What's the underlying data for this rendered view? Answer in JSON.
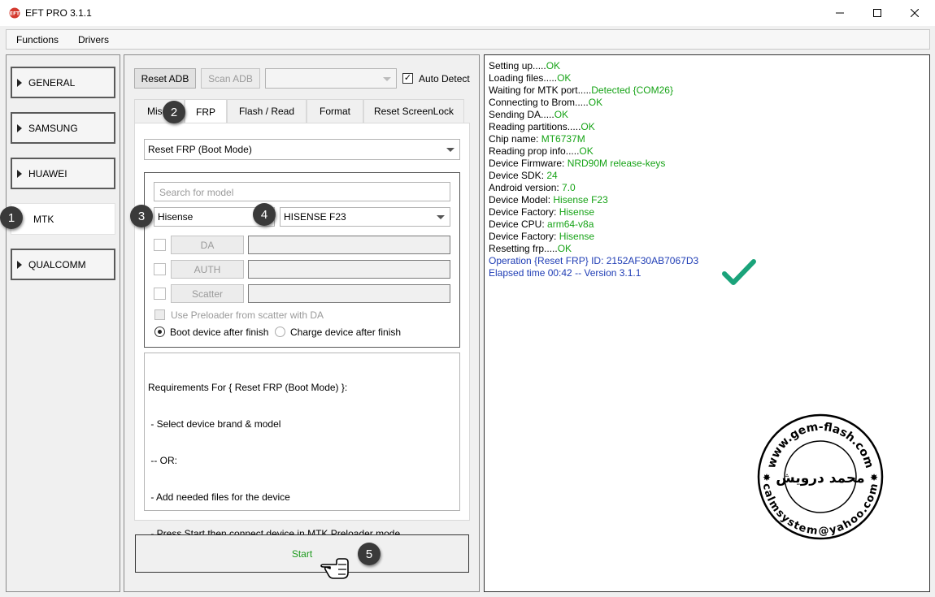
{
  "window": {
    "title": "EFT PRO 3.1.1",
    "controls": [
      "minimize-icon",
      "maximize-icon",
      "close-icon"
    ]
  },
  "menu": {
    "items": [
      "Functions",
      "Drivers"
    ]
  },
  "sidebar": {
    "items": [
      {
        "label": "GENERAL",
        "active": false
      },
      {
        "label": "SAMSUNG",
        "active": false
      },
      {
        "label": "HUAWEI",
        "active": false
      },
      {
        "label": "MTK",
        "active": true
      },
      {
        "label": "QUALCOMM",
        "active": false
      }
    ]
  },
  "toolbar": {
    "reset_adb": "Reset ADB",
    "scan_adb": "Scan ADB",
    "port_value": "",
    "auto_detect": "Auto Detect",
    "auto_detect_checked": true
  },
  "tabs": [
    {
      "label": "Misc",
      "active": false
    },
    {
      "label": "FRP",
      "active": true
    },
    {
      "label": "Flash / Read",
      "active": false
    },
    {
      "label": "Format",
      "active": false
    },
    {
      "label": "Reset ScreenLock",
      "active": false
    }
  ],
  "frp": {
    "mode_value": "Reset FRP (Boot Mode)",
    "search_placeholder": "Search for model",
    "brand_value": "Hisense",
    "model_value": "HISENSE F23",
    "da_label": "DA",
    "auth_label": "AUTH",
    "scatter_label": "Scatter",
    "use_preloader": "Use Preloader from scatter with DA",
    "boot_after": "Boot device after finish",
    "charge_after": "Charge device after finish",
    "boot_after_selected": true
  },
  "requirements": [
    "Requirements For { Reset FRP (Boot Mode) }:",
    " - Select device brand & model",
    " -- OR:",
    " - Add needed files for the device",
    " - Press Start then connect device in MTK Preloader mode"
  ],
  "start_label": "Start",
  "badges": [
    "1",
    "2",
    "3",
    "4",
    "5"
  ],
  "log": [
    {
      "label": "Setting up.....",
      "value": "OK"
    },
    {
      "label": "Loading files.....",
      "value": "OK"
    },
    {
      "label": "Waiting for MTK port.....",
      "value": "Detected {COM26}"
    },
    {
      "label": "Connecting to Brom.....",
      "value": "OK"
    },
    {
      "label": "Sending DA.....",
      "value": "OK"
    },
    {
      "label": "Reading partitions.....",
      "value": "OK"
    },
    {
      "label": "Chip name: ",
      "value": "MT6737M"
    },
    {
      "label": "Reading prop info.....",
      "value": "OK"
    },
    {
      "label": "Device Firmware: ",
      "value": "NRD90M release-keys"
    },
    {
      "label": "Device SDK: ",
      "value": "24"
    },
    {
      "label": "Android version: ",
      "value": "7.0"
    },
    {
      "label": "Device Model: ",
      "value": "Hisense F23"
    },
    {
      "label": "Device Factory: ",
      "value": "Hisense"
    },
    {
      "label": "Device CPU: ",
      "value": "arm64-v8a"
    },
    {
      "label": "Device Factory: ",
      "value": "Hisense"
    },
    {
      "label": "Resetting frp.....",
      "value": "OK"
    }
  ],
  "log_info": [
    "Operation {Reset FRP} ID: 2152AF30AB7067D3",
    "Elapsed time 00:42 -- Version 3.1.1"
  ],
  "watermark": {
    "top_text": "www.gem-flash.com",
    "bottom_text": "calmsystem@yahoo.com",
    "name_text": "محمد درويش"
  },
  "colors": {
    "ok": "#16a316",
    "info": "#1f3db5",
    "check": "#1aa37a"
  }
}
